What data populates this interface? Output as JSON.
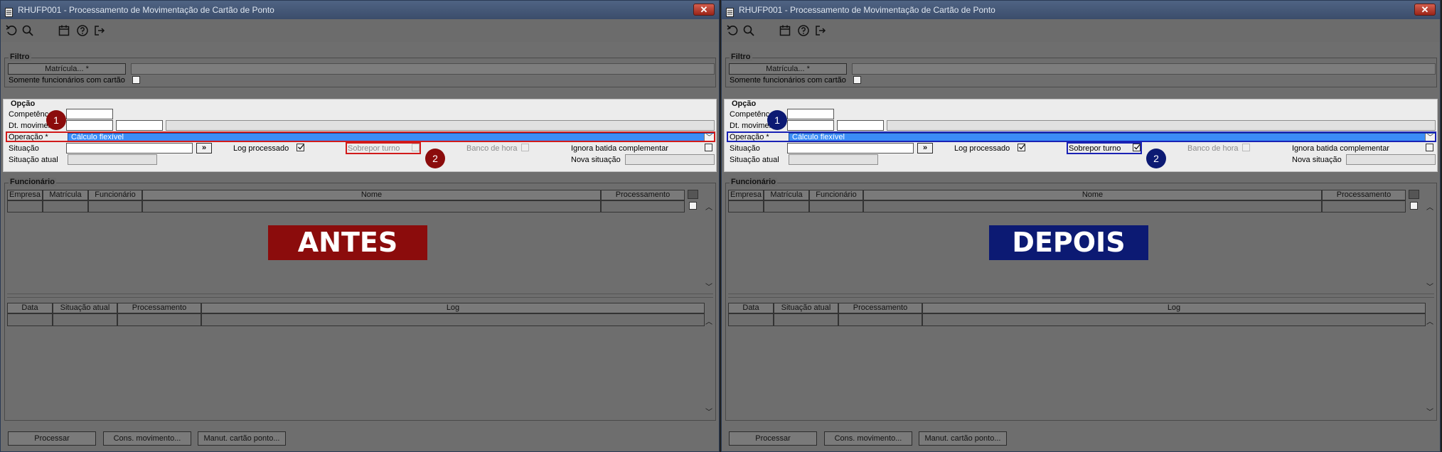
{
  "window": {
    "title": "RHUFP001 - Processamento de Movimentação de Cartão de Ponto",
    "close": "✕"
  },
  "toolbar": {
    "icons": [
      "undo-icon",
      "search-icon",
      "calendar-icon",
      "help-icon",
      "exit-icon"
    ]
  },
  "filtro": {
    "legend": "Filtro",
    "matricula_button": "Matrícula... *",
    "somente_label": "Somente funcionários com cartão"
  },
  "opcao": {
    "legend": "Opção",
    "competencia_label": "Competênc",
    "dt_movimento_label": "Dt. movimen",
    "operacao_label": "Operação *",
    "operacao_value": "Cálculo flexível",
    "situacao_label": "Situação",
    "situacao_button": "»",
    "log_label": "Log processado",
    "sobrepor_label": "Sobrepor turno",
    "banco_label": "Banco de hora",
    "ignora_label": "Ignora batida complementar",
    "situacao_atual_label": "Situação atual",
    "nova_situacao_label": "Nova situação"
  },
  "funcionario": {
    "legend": "Funcionário",
    "columns": [
      "Empresa",
      "Matrícula",
      "Funcionário",
      "Nome",
      "Processamento"
    ]
  },
  "log": {
    "columns": [
      "Data",
      "Situação atual",
      "Processamento",
      "Log"
    ]
  },
  "footer": {
    "processar": "Processar",
    "cons": "Cons. movimento...",
    "manut": "Manut. cartão ponto..."
  },
  "panels": [
    {
      "banner": "ANTES",
      "color": "#8b0c0c",
      "marker1": "1",
      "marker2": "2",
      "sobrepor_checked": false,
      "sobrepor_enabled": false
    },
    {
      "banner": "DEPOIS",
      "color": "#0c1a73",
      "marker1": "1",
      "marker2": "2",
      "sobrepor_checked": true,
      "sobrepor_enabled": true
    }
  ],
  "colors": {
    "select_blue": "#3b8df7",
    "titlebar": "#4f6383"
  }
}
